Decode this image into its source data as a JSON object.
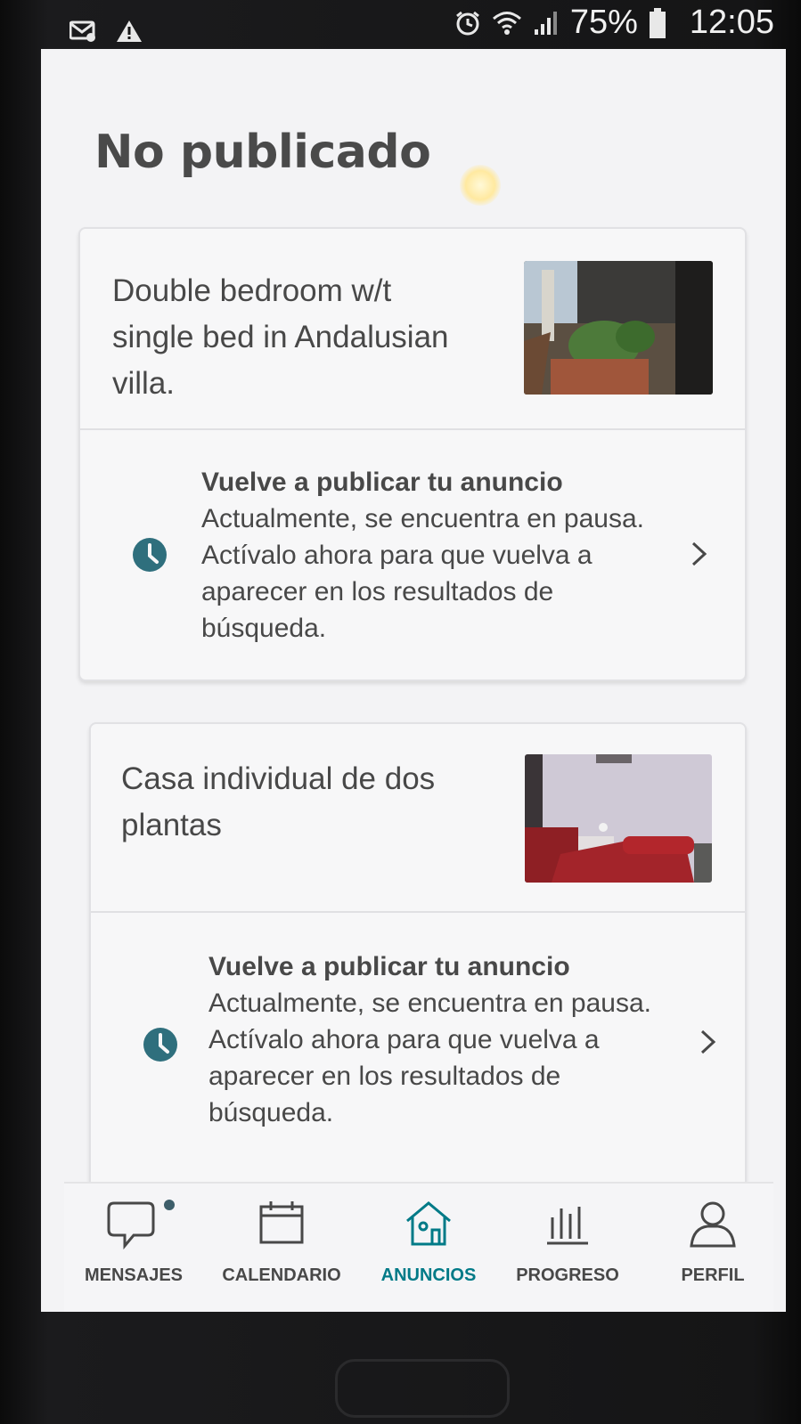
{
  "status_bar": {
    "battery_percent": "75%",
    "time": "12:05",
    "icons": [
      "mail-icon",
      "warning-icon",
      "alarm-icon",
      "wifi-icon",
      "signal-icon",
      "battery-icon"
    ]
  },
  "page": {
    "title": "No publicado"
  },
  "listings": [
    {
      "title": "Double bedroom w/t single bed in Andalusian villa.",
      "notice_title": "Vuelve a publicar tu anuncio",
      "notice_body": "Actualmente, se encuentra en pausa. Actívalo ahora para que vuelva a aparecer en los resultados de búsqueda.",
      "thumbnail": "patio-garden-photo"
    },
    {
      "title": "Casa individual de dos plantas",
      "notice_title": "Vuelve a publicar tu anuncio",
      "notice_body": "Actualmente, se encuentra en pausa. Actívalo ahora para que vuelva a aparecer en los resultados de búsqueda.",
      "thumbnail": "bedroom-red-beds-photo"
    }
  ],
  "bottom_nav": {
    "items": [
      {
        "label": "MENSAJES",
        "icon": "chat-bubble-icon"
      },
      {
        "label": "CALENDARIO",
        "icon": "calendar-icon"
      },
      {
        "label": "ANUNCIOS",
        "icon": "house-icon",
        "active": true
      },
      {
        "label": "PROGRESO",
        "icon": "progress-bars-icon"
      },
      {
        "label": "PERFIL",
        "icon": "person-icon"
      }
    ]
  },
  "colors": {
    "accent": "#007a87",
    "clock_icon": "#2f6f7d",
    "text": "#484848"
  }
}
